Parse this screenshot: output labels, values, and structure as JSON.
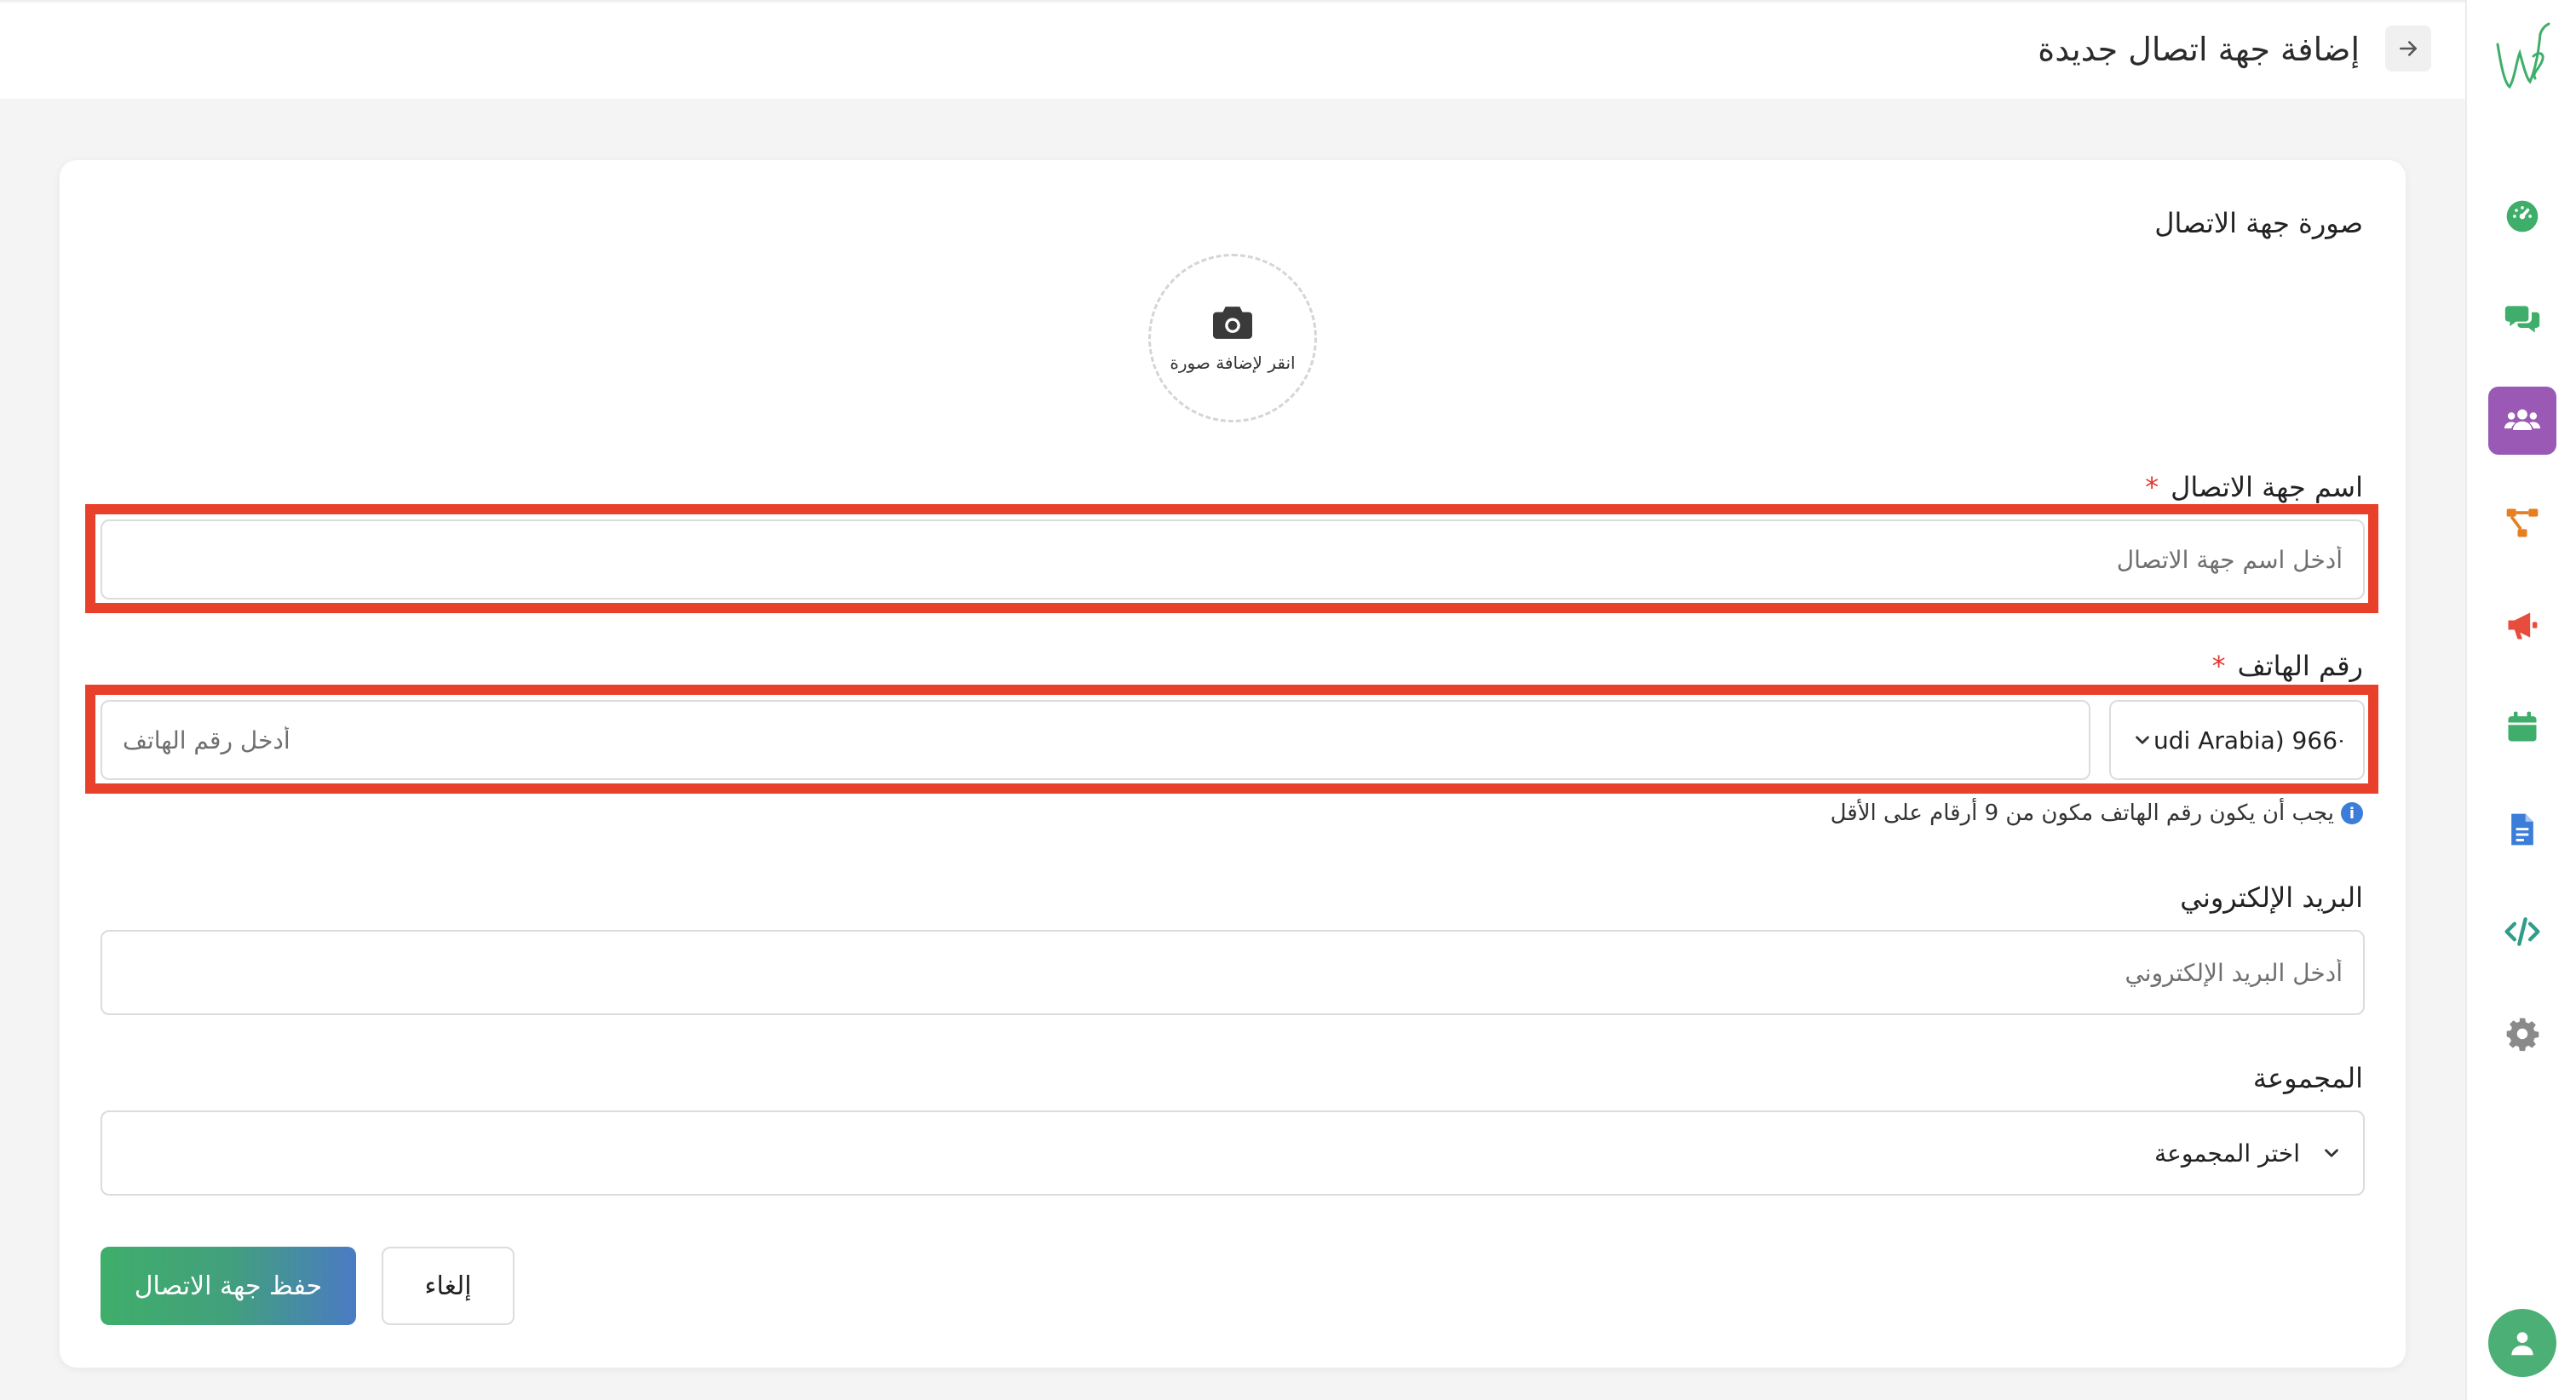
{
  "header": {
    "title": "إضافة جهة اتصال جديدة",
    "back_icon": "arrow-right-icon"
  },
  "sidebar": {
    "logo": "brand-logo",
    "items": [
      {
        "icon": "dashboard-gauge-icon",
        "color": "#3fae6a",
        "active": false
      },
      {
        "icon": "chat-bubbles-icon",
        "color": "#3fae6a",
        "active": false
      },
      {
        "icon": "contacts-users-icon",
        "color": "#ffffff",
        "active": true
      },
      {
        "icon": "flow-diagram-icon",
        "color": "#e67e22",
        "active": false
      },
      {
        "icon": "megaphone-icon",
        "color": "#e74c3c",
        "active": false
      },
      {
        "icon": "calendar-icon",
        "color": "#3fae6a",
        "active": false
      },
      {
        "icon": "document-icon",
        "color": "#3b7dd8",
        "active": false
      },
      {
        "icon": "code-icon",
        "color": "#2e9e8a",
        "active": false
      },
      {
        "icon": "gear-icon",
        "color": "#8a8a8a",
        "active": false
      }
    ],
    "active_color": "#9b59b6",
    "user_icon": "user-avatar-icon"
  },
  "form": {
    "photo": {
      "label": "صورة جهة الاتصال",
      "hint": "انقر لإضافة صورة",
      "icon": "camera-icon"
    },
    "name": {
      "label": "اسم جهة الاتصال",
      "required": "*",
      "placeholder": "أدخل اسم جهة الاتصال",
      "value": ""
    },
    "phone": {
      "label": "رقم الهاتف",
      "required": "*",
      "country_code": "udi Arabia) 966+",
      "placeholder": "أدخل رقم الهاتف",
      "value": "",
      "hint": "يجب أن يكون رقم الهاتف مكون من 9 أرقام على الأقل",
      "hint_icon": "info-icon"
    },
    "email": {
      "label": "البريد الإلكتروني",
      "placeholder": "أدخل البريد الإلكتروني",
      "value": ""
    },
    "group": {
      "label": "المجموعة",
      "selected": "اختر المجموعة"
    },
    "buttons": {
      "save": "حفظ جهة الاتصال",
      "cancel": "إلغاء"
    }
  },
  "colors": {
    "highlight": "#e8402a",
    "brand_green": "#3fae6a",
    "brand_blue": "#4a7bc4"
  }
}
